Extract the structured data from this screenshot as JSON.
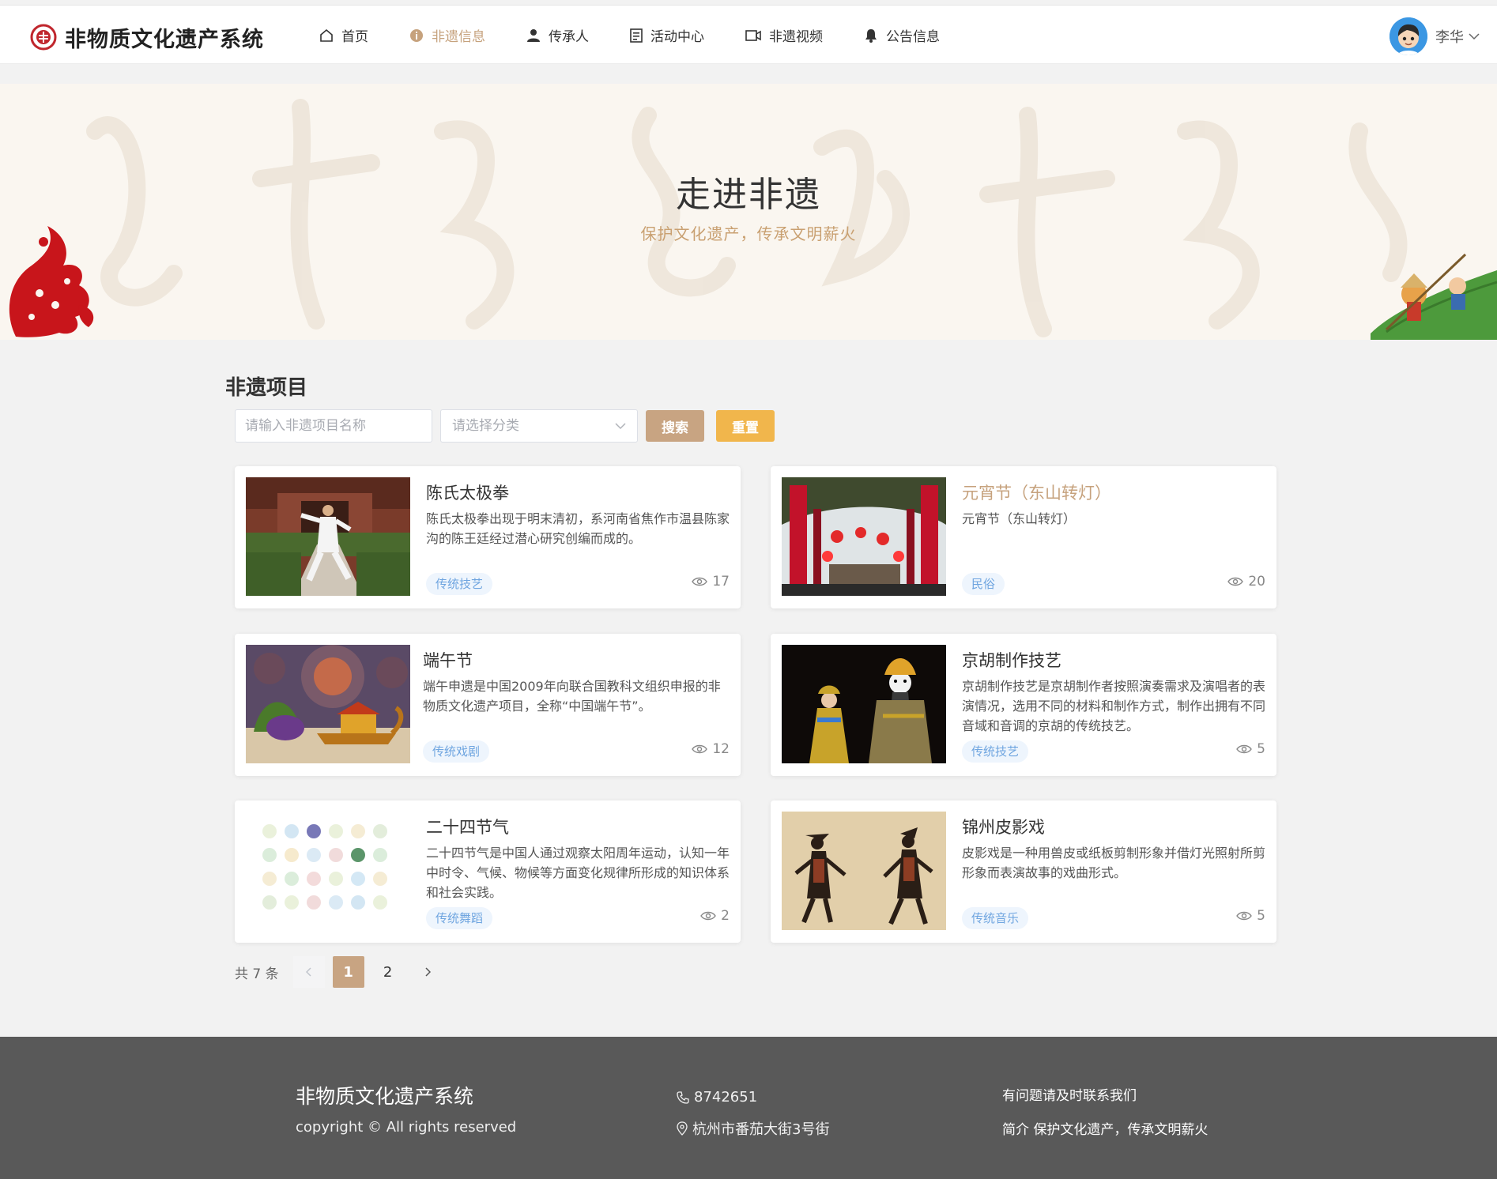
{
  "app": {
    "title": "非物质文化遗产系统"
  },
  "nav": {
    "items": [
      {
        "label": "首页",
        "icon": "home-icon"
      },
      {
        "label": "非遗信息",
        "icon": "info-icon",
        "active": true
      },
      {
        "label": "传承人",
        "icon": "user-icon"
      },
      {
        "label": "活动中心",
        "icon": "document-icon"
      },
      {
        "label": "非遗视频",
        "icon": "video-icon"
      },
      {
        "label": "公告信息",
        "icon": "bell-icon"
      }
    ]
  },
  "user": {
    "name": "李华"
  },
  "banner": {
    "title": "走进非遗",
    "subtitle": "保护文化遗产，传承文明薪火"
  },
  "section": {
    "title": "非遗项目",
    "search_placeholder": "请输入非遗项目名称",
    "category_placeholder": "请选择分类",
    "search_button": "搜索",
    "reset_button": "重置"
  },
  "projects": [
    {
      "title": "陈氏太极拳",
      "desc": "陈氏太极拳出现于明末清初，系河南省焦作市温县陈家沟的陈王廷经过潜心研究创编而成的。",
      "tag": "传统技艺",
      "views": "17"
    },
    {
      "title": "元宵节（东山转灯）",
      "desc": "元宵节（东山转灯）",
      "tag": "民俗",
      "views": "20"
    },
    {
      "title": "端午节",
      "desc": "端午申遗是中国2009年向联合国教科文组织申报的非物质文化遗产项目，全称“中国端午节”。",
      "tag": "传统戏剧",
      "views": "12"
    },
    {
      "title": "京胡制作技艺",
      "desc": "京胡制作技艺是京胡制作者按照演奏需求及演唱者的表演情况，选用不同的材料和制作方式，制作出拥有不同音域和音调的京胡的传统技艺。",
      "tag": "传统技艺",
      "views": "5"
    },
    {
      "title": "二十四节气",
      "desc": "二十四节气是中国人通过观察太阳周年运动，认知一年中时令、气候、物候等方面变化规律所形成的知识体系和社会实践。",
      "tag": "传统舞蹈",
      "views": "2"
    },
    {
      "title": "锦州皮影戏",
      "desc": "皮影戏是一种用兽皮或纸板剪制形象并借灯光照射所剪形象而表演故事的戏曲形式。",
      "tag": "传统音乐",
      "views": "5"
    }
  ],
  "pagination": {
    "total": "共 7 条",
    "pages": [
      "1",
      "2"
    ],
    "current": "1"
  },
  "footer": {
    "title": "非物质文化遗产系统",
    "copyright": "copyright © All rights reserved",
    "phone": "8742651",
    "address": "杭州市番茄大街3号街",
    "contact_title": "有问题请及时联系我们",
    "intro": "简介 保护文化遗产，传承文明薪火"
  },
  "colors": {
    "accent": "#c6a27d",
    "search_button": "#c8a482",
    "reset_button": "#f1b64c",
    "tag_bg": "#eef5fd",
    "tag_text": "#6fa5e0",
    "footer_bg": "#595959"
  }
}
